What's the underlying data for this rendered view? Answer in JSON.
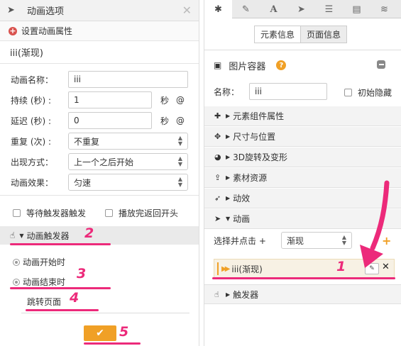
{
  "left_panel": {
    "title": "动画选项",
    "set_props": "设置动画属性",
    "item_name": "iii(渐现)",
    "fields": {
      "name_label": "动画名称：",
      "name_value": "iii",
      "duration_label": "持续 (秒) :",
      "duration_value": "1",
      "delay_label": "延迟 (秒) :",
      "delay_value": "0",
      "repeat_label": "重复 (次) :",
      "repeat_value": "不重复",
      "appear_label": "出现方式：",
      "appear_value": "上一个之后开始",
      "effect_label": "动画效果：",
      "effect_value": "匀速",
      "sec_unit": "秒",
      "at_symbol": "@"
    },
    "checks": {
      "wait_trigger": "等待触发器触发",
      "replay": "播放完返回开头"
    },
    "trigger": {
      "header": "动画触发器",
      "start": "动画开始时",
      "end": "动画结束时",
      "jump": "跳转页面"
    },
    "ok_icon": "✔"
  },
  "right_panel": {
    "tabs": [
      {
        "icon": "gear-icon",
        "glyph": "✱"
      },
      {
        "icon": "pencil-icon",
        "glyph": "✎"
      },
      {
        "icon": "font-icon",
        "glyph": "A"
      },
      {
        "icon": "send-icon",
        "glyph": "➤"
      },
      {
        "icon": "list-icon",
        "glyph": "☰"
      },
      {
        "icon": "document-icon",
        "glyph": "▤"
      },
      {
        "icon": "database-icon",
        "glyph": "≋"
      }
    ],
    "seg_element": "元素信息",
    "seg_page": "页面信息",
    "container_title": "图片容器",
    "help": "?",
    "name_label": "名称：",
    "name_value": "iii",
    "hidden_label": "初始隐藏",
    "sections": [
      {
        "label": "元素组件属性",
        "icon": "puzzle-icon",
        "glyph": "✚"
      },
      {
        "label": "尺寸与位置",
        "icon": "move-icon",
        "glyph": "✥"
      },
      {
        "label": "3D旋转及变形",
        "icon": "globe-icon",
        "glyph": "◕"
      },
      {
        "label": "素材资源",
        "icon": "upload-icon",
        "glyph": "⇪"
      },
      {
        "label": "动效",
        "icon": "rocket-icon",
        "glyph": "➶"
      },
      {
        "label": "动画",
        "icon": "send-icon",
        "glyph": "➤"
      }
    ],
    "select_click": "选择并点击 +",
    "effect_select": "渐现",
    "plus": "+",
    "anim_item": "iii(渐现)",
    "trigger_section": "触发器"
  },
  "annotations": {
    "n1": "1",
    "n2": "2",
    "n3": "3",
    "n4": "4",
    "n5": "5"
  },
  "colors": {
    "accent_orange": "#f0a026",
    "annotation_pink": "#ec2a7a",
    "red_icon": "#d9534f"
  }
}
